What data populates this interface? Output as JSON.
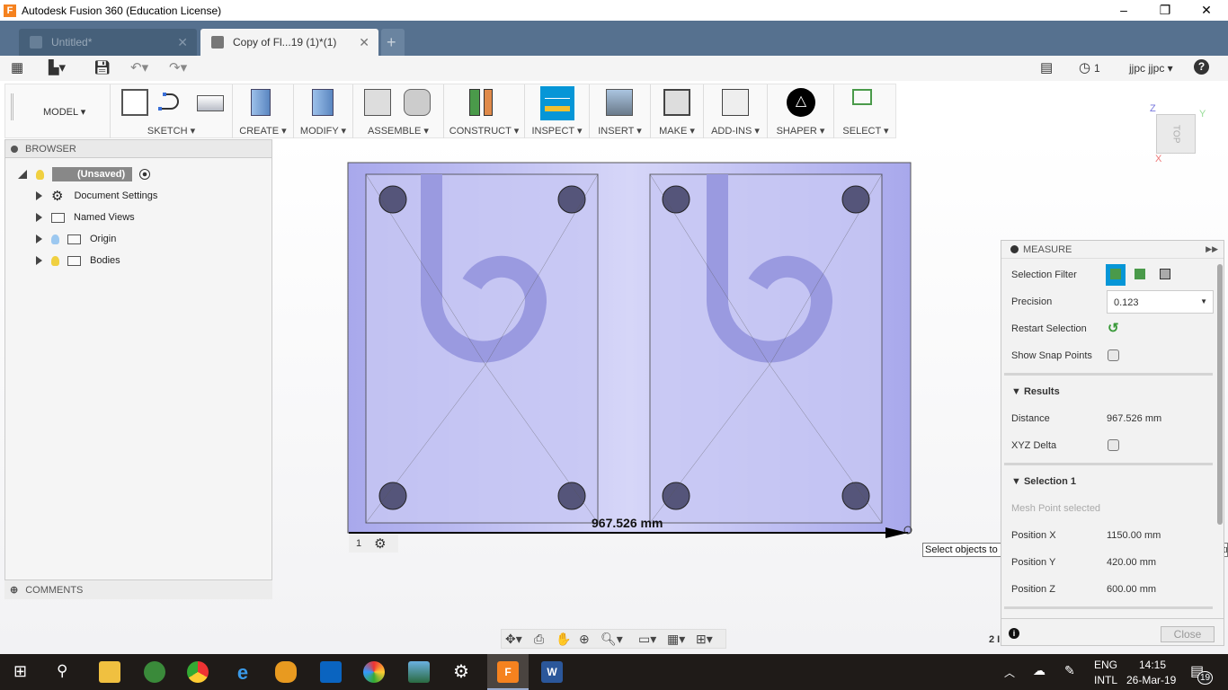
{
  "window": {
    "title": "Autodesk Fusion 360 (Education License)",
    "minimize": "–",
    "maximize": "❐",
    "close": "✕"
  },
  "tabs": [
    {
      "label": "Untitled*",
      "active": false
    },
    {
      "label": "Copy of Fl...19 (1)*(1)",
      "active": true
    }
  ],
  "tab_close": "✕",
  "new_tab": "+",
  "quickbar": {
    "jobs": "1",
    "user": "jjpc jjpc ▾",
    "help": "?"
  },
  "ribbon": {
    "workspace": "MODEL ▾",
    "groups": [
      "SKETCH ▾",
      "CREATE ▾",
      "MODIFY ▾",
      "ASSEMBLE ▾",
      "CONSTRUCT ▾",
      "INSPECT ▾",
      "INSERT ▾",
      "MAKE ▾",
      "ADD-INS ▾",
      "SHAPER ▾",
      "SELECT ▾"
    ],
    "active": "INSPECT"
  },
  "viewcube": {
    "face": "TOP",
    "x": "X",
    "y": "Y",
    "z": "Z"
  },
  "browser": {
    "title": "BROWSER",
    "root": "(Unsaved)",
    "items": [
      "Document Settings",
      "Named Views",
      "Origin",
      "Bodies"
    ],
    "comments": "COMMENTS"
  },
  "viewport": {
    "dimension": "967.526 mm",
    "marker_index": "1",
    "tooltip": "Select objects to measure. Hold Shift to remove snap points. Hold Ctrl",
    "partial_text": "2 I"
  },
  "measure": {
    "title": "MEASURE",
    "selection_filter": "Selection Filter",
    "precision_label": "Precision",
    "precision_value": "0.123",
    "restart": "Restart Selection",
    "snap": "Show Snap Points",
    "results": "Results",
    "distance_label": "Distance",
    "distance_value": "967.526 mm",
    "xyz_delta": "XYZ Delta",
    "selection1": "Selection 1",
    "selection_status": "Mesh Point selected",
    "pos_x_label": "Position X",
    "pos_x": "1150.00 mm",
    "pos_y_label": "Position Y",
    "pos_y": "420.00 mm",
    "pos_z_label": "Position Z",
    "pos_z": "600.00 mm",
    "close": "Close"
  },
  "taskbar": {
    "lang1": "ENG",
    "lang2": "INTL",
    "time": "14:15",
    "date": "26-Mar-19",
    "notifications": "19"
  },
  "colors": {
    "tabbar": "#56718f",
    "accent": "#0696d7",
    "model": "#b8b8f0"
  }
}
